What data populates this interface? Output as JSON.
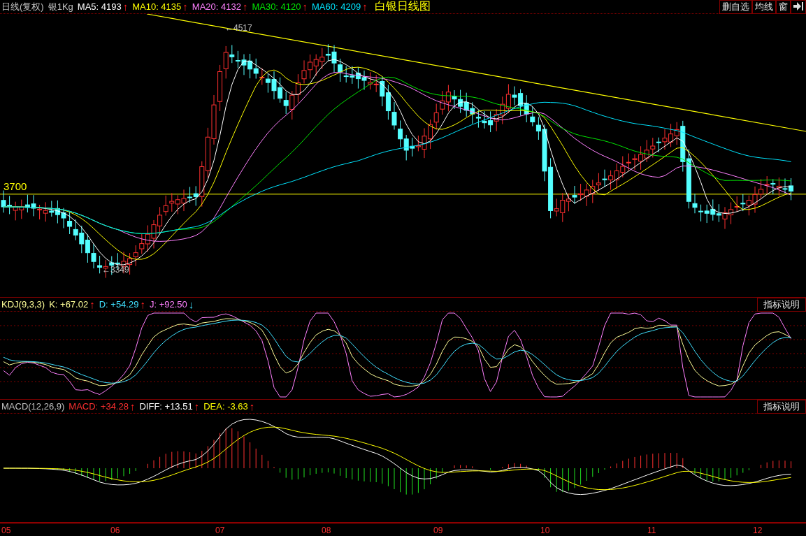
{
  "header": {
    "period": "日线(复权)",
    "symbol": "银1Kg",
    "indicators": [
      {
        "label": "MA5: 4193",
        "color": "#ffffff",
        "trend": "↑"
      },
      {
        "label": "MA10: 4135",
        "color": "#ffff00",
        "trend": "↑"
      },
      {
        "label": "MA20: 4132",
        "color": "#ff80ff",
        "trend": "↑"
      },
      {
        "label": "MA30: 4120",
        "color": "#00e600",
        "trend": "↑"
      },
      {
        "label": "MA60: 4209",
        "color": "#00e5ff",
        "trend": "↑"
      }
    ],
    "title": "白银日线图",
    "buttons": [
      "删自选",
      "均线",
      "窗"
    ]
  },
  "main_chart": {
    "high_label": "←4517",
    "low_label": "←3349",
    "line_label": "3700"
  },
  "kdj": {
    "name": "KDJ(9,3,3)",
    "values": [
      {
        "label": "K: +67.02",
        "color": "#ffff99",
        "trend": "↑"
      },
      {
        "label": "D: +54.29",
        "color": "#40e0ff",
        "trend": "↑"
      },
      {
        "label": "J: +92.50",
        "color": "#ff80ff",
        "trend": "↓"
      }
    ],
    "help": "指标说明"
  },
  "macd": {
    "name": "MACD(12,26,9)",
    "values": [
      {
        "label": "MACD: +34.28",
        "color": "#ff3030",
        "trend": "↑"
      },
      {
        "label": "DIFF: +13.51",
        "color": "#ffffff",
        "trend": "↑"
      },
      {
        "label": "DEA: -3.63",
        "color": "#ffff00",
        "trend": "↑"
      }
    ],
    "help": "指标说明"
  },
  "x_axis": [
    "05",
    "06",
    "07",
    "08",
    "09",
    "10",
    "11",
    "12"
  ]
}
